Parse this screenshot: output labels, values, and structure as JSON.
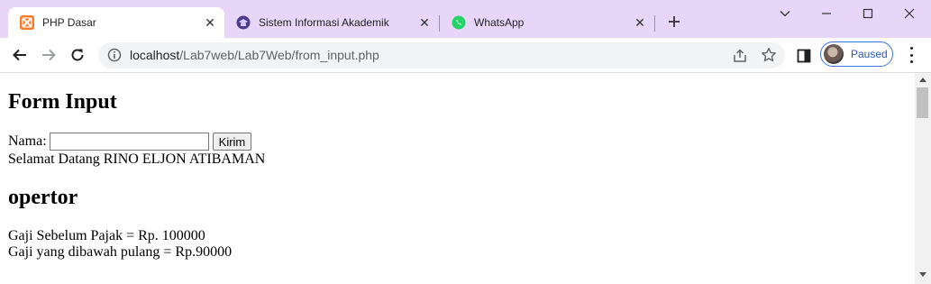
{
  "tabs": [
    {
      "title": "PHP Dasar",
      "icon": "xampp-icon",
      "active": true
    },
    {
      "title": "Sistem Informasi Akademik",
      "icon": "academic-icon",
      "active": false
    },
    {
      "title": "WhatsApp",
      "icon": "whatsapp-icon",
      "active": false
    }
  ],
  "omnibox": {
    "url_host": "localhost",
    "url_path": "/Lab7web/Lab7Web/from_input.php"
  },
  "profile": {
    "label": "Paused"
  },
  "page": {
    "heading": "Form Input",
    "name_label": "Nama:",
    "name_value": "",
    "submit_label": "Kirim",
    "welcome": "Selamat Datang RINO ELJON ATIBAMAN",
    "section_heading": "opertor",
    "line1": "Gaji Sebelum Pajak = Rp. 100000",
    "line2": "Gaji yang dibawah pulang = Rp.90000"
  },
  "colors": {
    "tabstrip": "#e8d6f9",
    "profile_accent": "#2b59b8"
  }
}
